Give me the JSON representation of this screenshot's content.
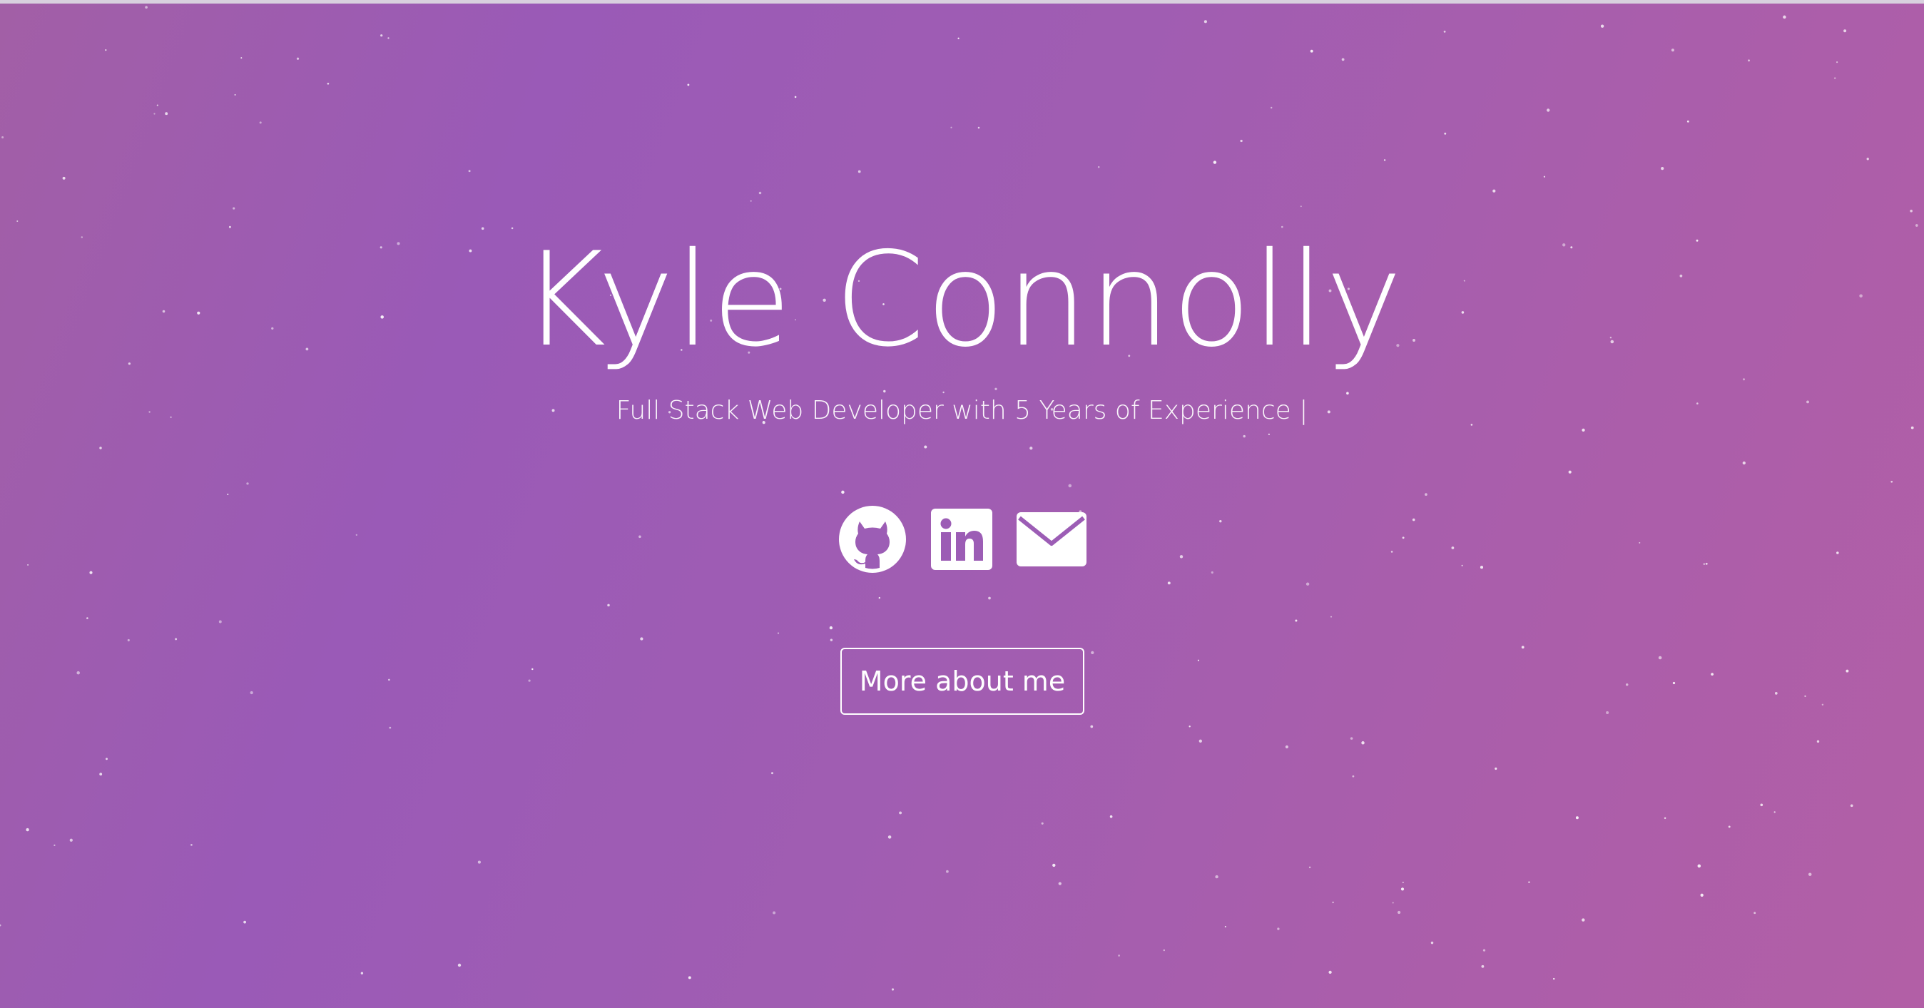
{
  "hero": {
    "name": "Kyle Connolly",
    "subtitle": "Full Stack Web Developer with 5 Years of Experience |"
  },
  "social": {
    "icons": [
      "github-icon",
      "linkedin-icon",
      "mail-icon"
    ]
  },
  "cta": {
    "label": "More about me"
  },
  "colors": {
    "background_start": "#a25fa6",
    "background_mid": "#9a5ab7",
    "background_end": "#b25fa6",
    "text": "#ffffff"
  }
}
